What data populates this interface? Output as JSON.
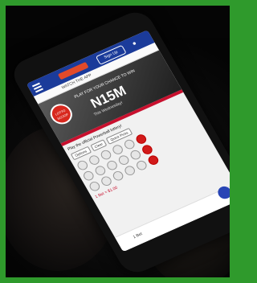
{
  "photo": {
    "subject": "hand holding smartphone"
  },
  "app": {
    "topbar": {
      "account_button": "Sign Up"
    },
    "tab_label": "WATCH THE APP",
    "banner": {
      "seal_text": "LOTTO SCOOP",
      "tagline": "PLAY FOR YOUR CHANCE TO WIN",
      "jackpot": "N15M",
      "subline": "This Wednesday!"
    },
    "prompt": "Play the official Powerball lottery!",
    "chips": [
      "Options",
      "Clear",
      "Quick Picks"
    ],
    "note": "1 Bet = $1.00",
    "footer_label": "1 Bet"
  },
  "colors": {
    "border_green": "#2f9a2c",
    "app_blue": "#1b3b9a",
    "accent_red": "#c8102e"
  }
}
